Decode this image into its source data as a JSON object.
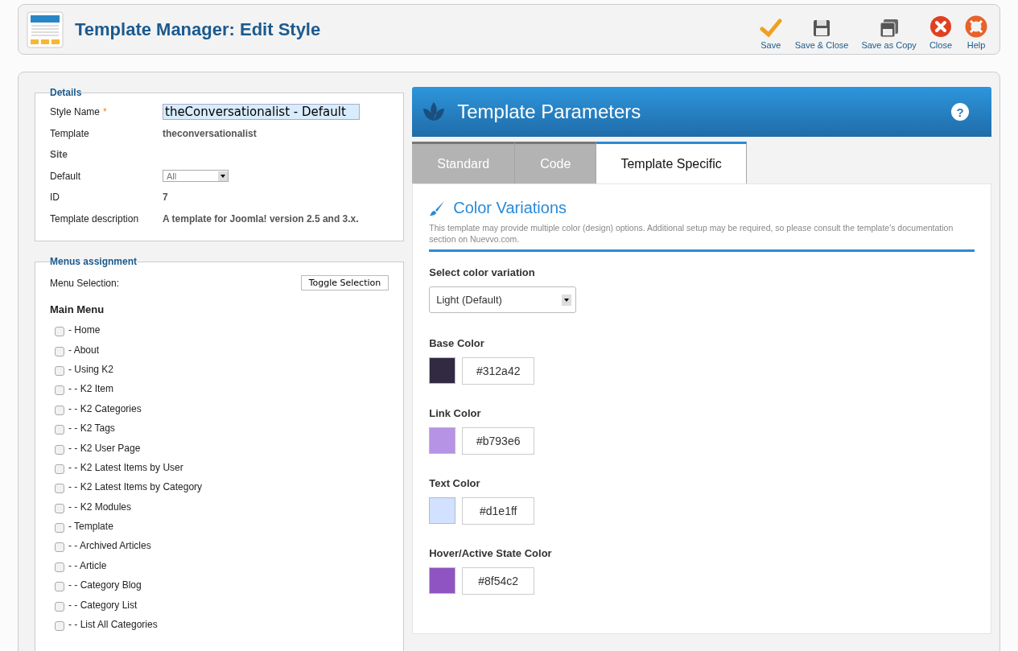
{
  "header": {
    "title": "Template Manager: Edit Style"
  },
  "toolbar": [
    {
      "label": "Save",
      "kind": "check"
    },
    {
      "label": "Save & Close",
      "kind": "save"
    },
    {
      "label": "Save as Copy",
      "kind": "copy"
    },
    {
      "label": "Close",
      "kind": "close"
    },
    {
      "label": "Help",
      "kind": "help"
    }
  ],
  "details": {
    "legend": "Details",
    "style_name_label": "Style Name",
    "required_mark": "*",
    "style_name_value": "theConversationalist - Default",
    "template_label": "Template",
    "template_value": "theconversationalist",
    "site_label": "Site",
    "default_label": "Default",
    "default_value": "All",
    "id_label": "ID",
    "id_value": "7",
    "description_label": "Template description",
    "description_value": "A template for Joomla! version 2.5 and 3.x."
  },
  "menus": {
    "legend": "Menus assignment",
    "selection_label": "Menu Selection:",
    "toggle_button": "Toggle Selection",
    "menu_title": "Main Menu",
    "items": [
      {
        "label": "- Home",
        "checked": false
      },
      {
        "label": "- About",
        "checked": false
      },
      {
        "label": "- Using K2",
        "checked": false,
        "children": [
          {
            "label": "- - K2 Item",
            "checked": false
          },
          {
            "label": "- - K2 Categories",
            "checked": false
          },
          {
            "label": "- - K2 Tags",
            "checked": false
          },
          {
            "label": "- - K2 User Page",
            "checked": false
          },
          {
            "label": "- - K2 Latest Items by User",
            "checked": false
          },
          {
            "label": "- - K2 Latest Items by Category",
            "checked": false
          },
          {
            "label": "- - K2 Modules",
            "checked": false
          }
        ]
      },
      {
        "label": "- Template",
        "checked": false,
        "children": [
          {
            "label": "- - Archived Articles",
            "checked": false
          },
          {
            "label": "- - Article",
            "checked": false
          },
          {
            "label": "- - Category Blog",
            "checked": false
          },
          {
            "label": "- - Category List",
            "checked": false
          },
          {
            "label": "- - List All Categories",
            "checked": false
          }
        ]
      }
    ]
  },
  "parameters": {
    "title": "Template Parameters",
    "help": "?",
    "tabs": [
      {
        "label": "Standard",
        "selected": false
      },
      {
        "label": "Code",
        "selected": false
      },
      {
        "label": "Template Specific",
        "selected": true
      }
    ],
    "section_title": "Color Variations",
    "section_text": "This template may provide multiple color (design) options. Additional setup may be required, so please consult the template's documentation section on Nuevvo.com.",
    "variation_label": "Select color variation",
    "variation_value": "Light (Default)",
    "colors": [
      {
        "label": "Base Color",
        "value": "#312a42",
        "color": "#312a42"
      },
      {
        "label": "Link Color",
        "value": "#b793e6",
        "color": "#b793e6"
      },
      {
        "label": "Text Color",
        "value": "#d1e1ff",
        "color": "#d1e1ff"
      },
      {
        "label": "Hover/Active State Color",
        "value": "#8f54c2",
        "color": "#8f54c2"
      }
    ]
  }
}
